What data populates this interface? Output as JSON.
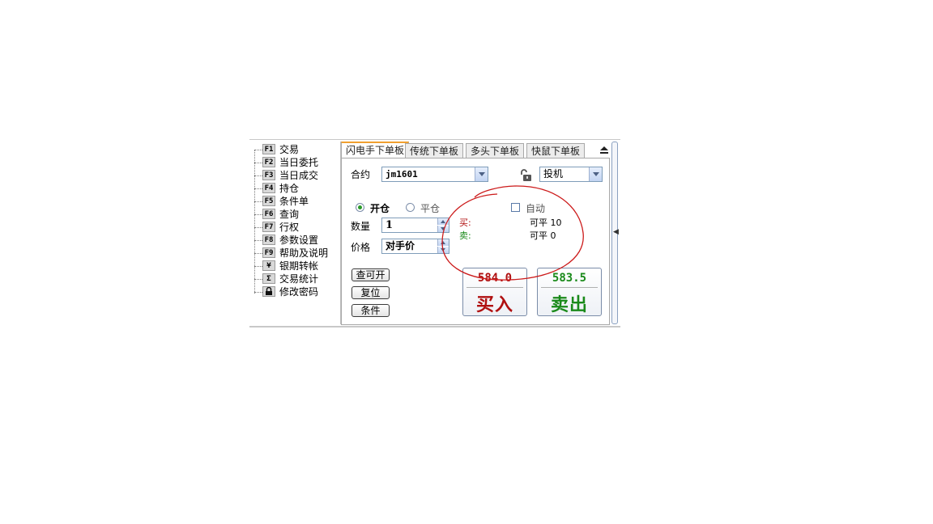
{
  "menu": [
    {
      "key": "F1",
      "label": "交易"
    },
    {
      "key": "F2",
      "label": "当日委托"
    },
    {
      "key": "F3",
      "label": "当日成交"
    },
    {
      "key": "F4",
      "label": "持仓"
    },
    {
      "key": "F5",
      "label": "条件单"
    },
    {
      "key": "F6",
      "label": "查询"
    },
    {
      "key": "F7",
      "label": "行权"
    },
    {
      "key": "F8",
      "label": "参数设置"
    },
    {
      "key": "F9",
      "label": "帮助及说明"
    },
    {
      "key": "¥",
      "label": "银期转帐"
    },
    {
      "key": "Σ",
      "label": "交易统计"
    },
    {
      "key": "lock-icon",
      "label": "修改密码"
    }
  ],
  "tabs": [
    "闪电手下单板",
    "传统下单板",
    "多头下单板",
    "快鼠下单板"
  ],
  "form": {
    "contract_label": "合约",
    "contract_value": "jm1601",
    "hedge_value": "投机",
    "open_label": "开仓",
    "close_label": "平仓",
    "auto_label": "自动",
    "qty_label": "数量",
    "qty_value": "1",
    "price_label": "价格",
    "price_value": "对手价"
  },
  "position": {
    "buy_label": "买:",
    "sell_label": "卖:",
    "buy_closable": "可平 10",
    "sell_closable": "可平 0"
  },
  "buttons": {
    "query_open": "查可开",
    "reset": "复位",
    "condition": "条件"
  },
  "trade": {
    "buy_price": "584.0",
    "buy_label": "买入",
    "sell_price": "583.5",
    "sell_label": "卖出"
  },
  "colors": {
    "buy": "#b01010",
    "sell": "#1a8a1a",
    "annotation": "#cc1a1a",
    "tab_accent": "#f0a030"
  }
}
